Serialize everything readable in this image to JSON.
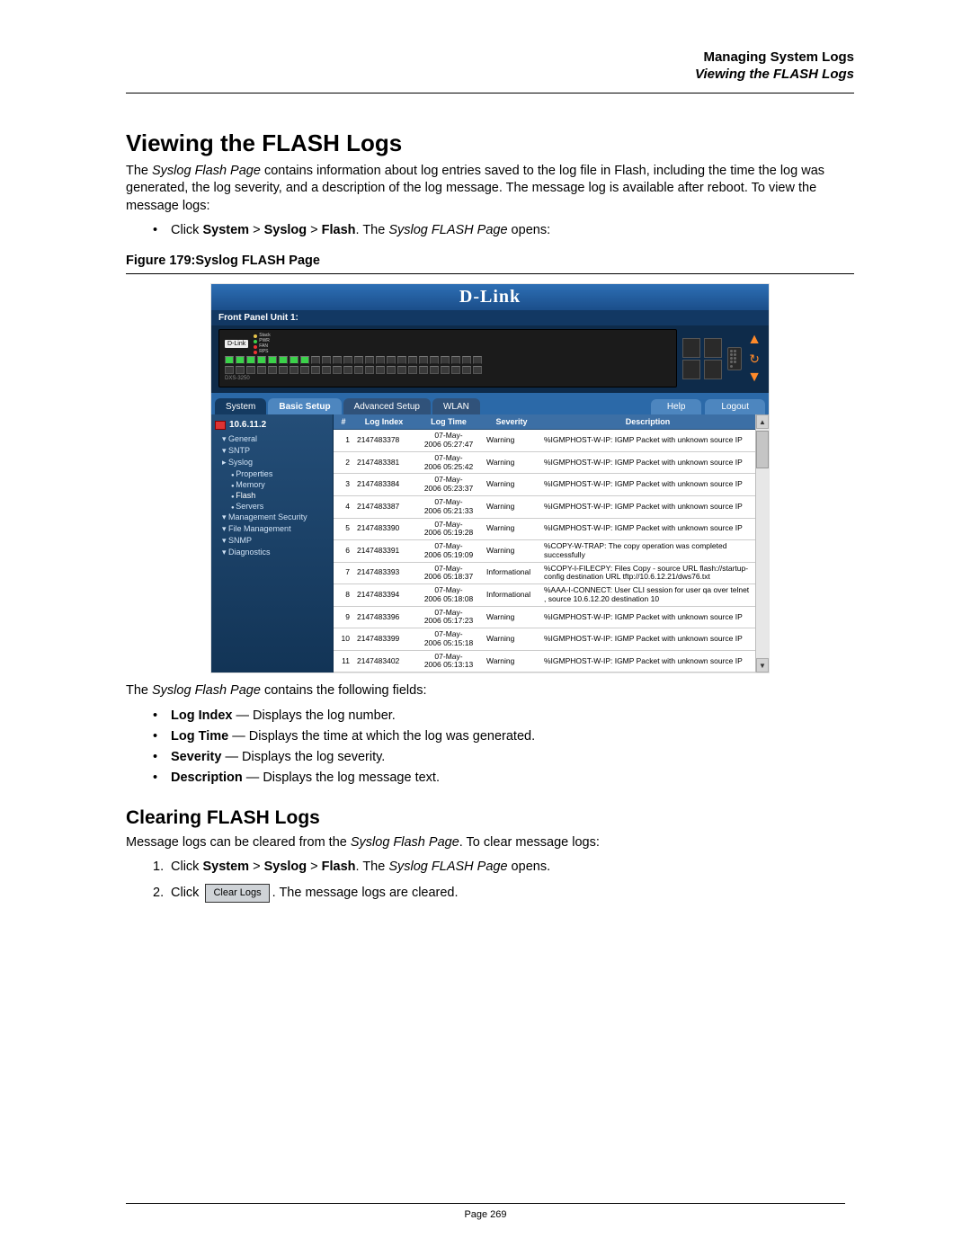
{
  "header": {
    "chapter": "Managing System Logs",
    "section": "Viewing the FLASH Logs"
  },
  "s1": {
    "title": "Viewing the FLASH Logs",
    "para1a": "The ",
    "para1b": "Syslog Flash Page",
    "para1c": " contains information about log entries saved to the log file in Flash, including the time the log was generated, the log severity, and a description of the log message. The message log is available after reboot. To view the message logs:",
    "bullet1a": "Click ",
    "bullet1b": "System",
    "bullet1c": " > ",
    "bullet1d": "Syslog",
    "bullet1e": " > ",
    "bullet1f": "Flash",
    "bullet1g": ". The ",
    "bullet1h": "Syslog FLASH Page",
    "bullet1i": " opens:",
    "figcap": "Figure 179:Syslog FLASH Page"
  },
  "shot": {
    "brand": "D-Link",
    "frontpanel": "Front Panel Unit 1:",
    "devlogo": "D-Link",
    "led1": "Stack",
    "led2": "PWR",
    "led3": "FAN",
    "led4": "RPS",
    "model": "DXS-3250",
    "tabs": {
      "system": "System",
      "basic": "Basic Setup",
      "adv": "Advanced Setup",
      "wlan": "WLAN",
      "help": "Help",
      "logout": "Logout"
    },
    "ip": "10.6.11.2",
    "tree": {
      "general": "General",
      "sntp": "SNTP",
      "syslog": "Syslog",
      "properties": "Properties",
      "memory": "Memory",
      "flash": "Flash",
      "servers": "Servers",
      "mgmt": "Management Security",
      "file": "File Management",
      "snmp": "SNMP",
      "diag": "Diagnostics"
    },
    "th": {
      "num": "#",
      "idx": "Log Index",
      "time": "Log Time",
      "sev": "Severity",
      "desc": "Description"
    },
    "rows": [
      {
        "n": "1",
        "idx": "2147483378",
        "t1": "07-May-",
        "t2": "2006 05:27:47",
        "sev": "Warning",
        "desc": "%IGMPHOST-W-IP: IGMP Packet with unknown source IP"
      },
      {
        "n": "2",
        "idx": "2147483381",
        "t1": "07-May-",
        "t2": "2006 05:25:42",
        "sev": "Warning",
        "desc": "%IGMPHOST-W-IP: IGMP Packet with unknown source IP"
      },
      {
        "n": "3",
        "idx": "2147483384",
        "t1": "07-May-",
        "t2": "2006 05:23:37",
        "sev": "Warning",
        "desc": "%IGMPHOST-W-IP: IGMP Packet with unknown source IP"
      },
      {
        "n": "4",
        "idx": "2147483387",
        "t1": "07-May-",
        "t2": "2006 05:21:33",
        "sev": "Warning",
        "desc": "%IGMPHOST-W-IP: IGMP Packet with unknown source IP"
      },
      {
        "n": "5",
        "idx": "2147483390",
        "t1": "07-May-",
        "t2": "2006 05:19:28",
        "sev": "Warning",
        "desc": "%IGMPHOST-W-IP: IGMP Packet with unknown source IP"
      },
      {
        "n": "6",
        "idx": "2147483391",
        "t1": "07-May-",
        "t2": "2006 05:19:09",
        "sev": "Warning",
        "desc": "%COPY-W-TRAP: The copy operation was completed successfully"
      },
      {
        "n": "7",
        "idx": "2147483393",
        "t1": "07-May-",
        "t2": "2006 05:18:37",
        "sev": "Informational",
        "desc": "%COPY-I-FILECPY: Files Copy - source URL flash://startup-config destination URL tftp://10.6.12.21/dws76.txt"
      },
      {
        "n": "8",
        "idx": "2147483394",
        "t1": "07-May-",
        "t2": "2006 05:18:08",
        "sev": "Informational",
        "desc": "%AAA-I-CONNECT: User CLI session for user qa over telnet , source 10.6.12.20 destination  10"
      },
      {
        "n": "9",
        "idx": "2147483396",
        "t1": "07-May-",
        "t2": "2006 05:17:23",
        "sev": "Warning",
        "desc": "%IGMPHOST-W-IP: IGMP Packet with unknown source IP"
      },
      {
        "n": "10",
        "idx": "2147483399",
        "t1": "07-May-",
        "t2": "2006 05:15:18",
        "sev": "Warning",
        "desc": "%IGMPHOST-W-IP: IGMP Packet with unknown source IP"
      },
      {
        "n": "11",
        "idx": "2147483402",
        "t1": "07-May-",
        "t2": "2006 05:13:13",
        "sev": "Warning",
        "desc": "%IGMPHOST-W-IP: IGMP Packet with unknown source IP"
      }
    ]
  },
  "fields_intro_a": "The ",
  "fields_intro_b": "Syslog Flash Page",
  "fields_intro_c": " contains the following fields:",
  "fields": [
    {
      "name": "Log Index",
      "dash": " — ",
      "desc": "Displays the log number."
    },
    {
      "name": "Log Time",
      "dash": " — ",
      "desc": "Displays the time at which the log was generated."
    },
    {
      "name": "Severity",
      "dash": " — ",
      "desc": "Displays the log severity."
    },
    {
      "name": "Description",
      "dash": " — ",
      "desc": "Displays the log message text."
    }
  ],
  "s2": {
    "title": "Clearing FLASH Logs",
    "p1a": "Message logs can be cleared from the ",
    "p1b": "Syslog Flash Page",
    "p1c": ". To clear message logs:",
    "step1a": "Click ",
    "step1b": "System",
    "step1c": " > ",
    "step1d": "Syslog",
    "step1e": " > ",
    "step1f": "Flash",
    "step1g": ". The ",
    "step1h": "Syslog FLASH Page",
    "step1i": " opens.",
    "step2a": "Click ",
    "btn": "Clear Logs",
    "step2b": ". The message logs are cleared."
  },
  "ol": {
    "n1": "1.",
    "n2": "2."
  },
  "footer": {
    "page": "Page 269"
  }
}
